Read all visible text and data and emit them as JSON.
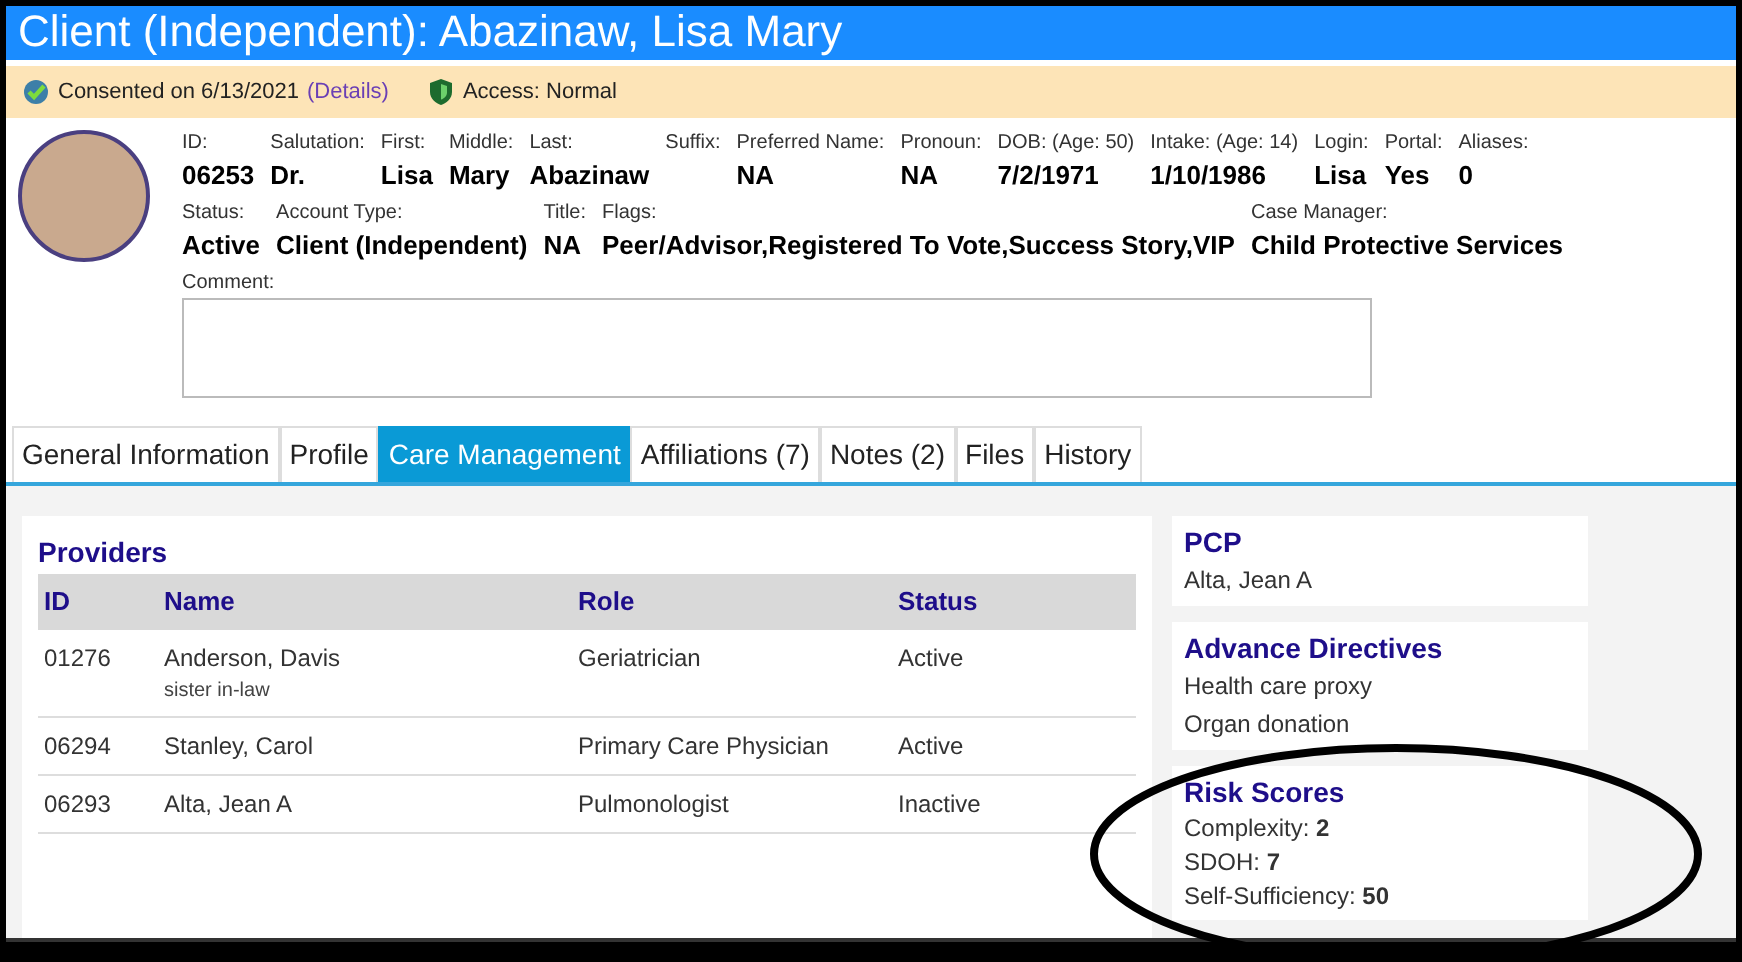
{
  "window": {
    "title": "Client (Independent): Abazinaw, Lisa Mary"
  },
  "consent_bar": {
    "consent": "Consented on 6/13/2021",
    "details_link": "(Details)",
    "access": "Access: Normal"
  },
  "header": {
    "fields_row_1": [
      {
        "label": "ID:",
        "value": "06253"
      },
      {
        "label": "Salutation:",
        "value": "Dr."
      },
      {
        "label": "First:",
        "value": "Lisa"
      },
      {
        "label": "Middle:",
        "value": "Mary"
      },
      {
        "label": "Last:",
        "value": "Abazinaw"
      },
      {
        "label": "Suffix:"
      },
      {
        "label": "Preferred Name:",
        "value": "NA"
      },
      {
        "label": "Pronoun:",
        "value": "NA"
      },
      {
        "label": "DOB: (Age: 50)",
        "value": "7/2/1971"
      },
      {
        "label": "Intake: (Age: 14)",
        "value": "1/10/1986"
      },
      {
        "label": "Login:",
        "value": "Lisa"
      },
      {
        "label": "Portal:",
        "value": "Yes"
      },
      {
        "label": "Aliases:",
        "value": "0"
      }
    ],
    "fields_row_2": [
      {
        "label": "Status:",
        "value": "Active"
      },
      {
        "label": "Account Type:",
        "value": "Client (Independent)"
      },
      {
        "label": "Title:",
        "value": "NA"
      },
      {
        "label": "Flags:",
        "value": "Peer/Advisor,Registered To Vote,Success Story,VIP"
      },
      {
        "label": "Case Manager:",
        "value": "Child Protective Services"
      }
    ],
    "comment_label": "Comment:"
  },
  "tabs": [
    {
      "label": "General Information",
      "selected": false
    },
    {
      "label": "Profile",
      "selected": false
    },
    {
      "label": "Care Management",
      "selected": true
    },
    {
      "label": "Affiliations (7)",
      "selected": false
    },
    {
      "label": "Notes (2)",
      "selected": false
    },
    {
      "label": "Files",
      "selected": false
    },
    {
      "label": "History",
      "selected": false
    }
  ],
  "providers": {
    "title": "Providers",
    "columns": [
      "ID",
      "Name",
      "Role",
      "Status"
    ],
    "rows": [
      {
        "id": "01276",
        "name": "Anderson, Davis",
        "note": "sister in-law",
        "role": "Geriatrician",
        "status": "Active"
      },
      {
        "id": "06294",
        "name": "Stanley, Carol",
        "role": "Primary Care Physician",
        "status": "Active"
      },
      {
        "id": "06293",
        "name": "Alta, Jean A",
        "role": "Pulmonologist",
        "status": "Inactive"
      }
    ]
  },
  "side_cards": [
    {
      "title": "PCP",
      "items": [
        "Alta, Jean A"
      ]
    },
    {
      "title": "Advance Directives",
      "items": [
        "Health care proxy",
        "Organ donation"
      ]
    },
    {
      "title": "Risk Scores",
      "items": [
        "Complexity: **2**",
        "SDOH: **7**",
        "Self-Sufficiency: **50**"
      ]
    }
  ]
}
